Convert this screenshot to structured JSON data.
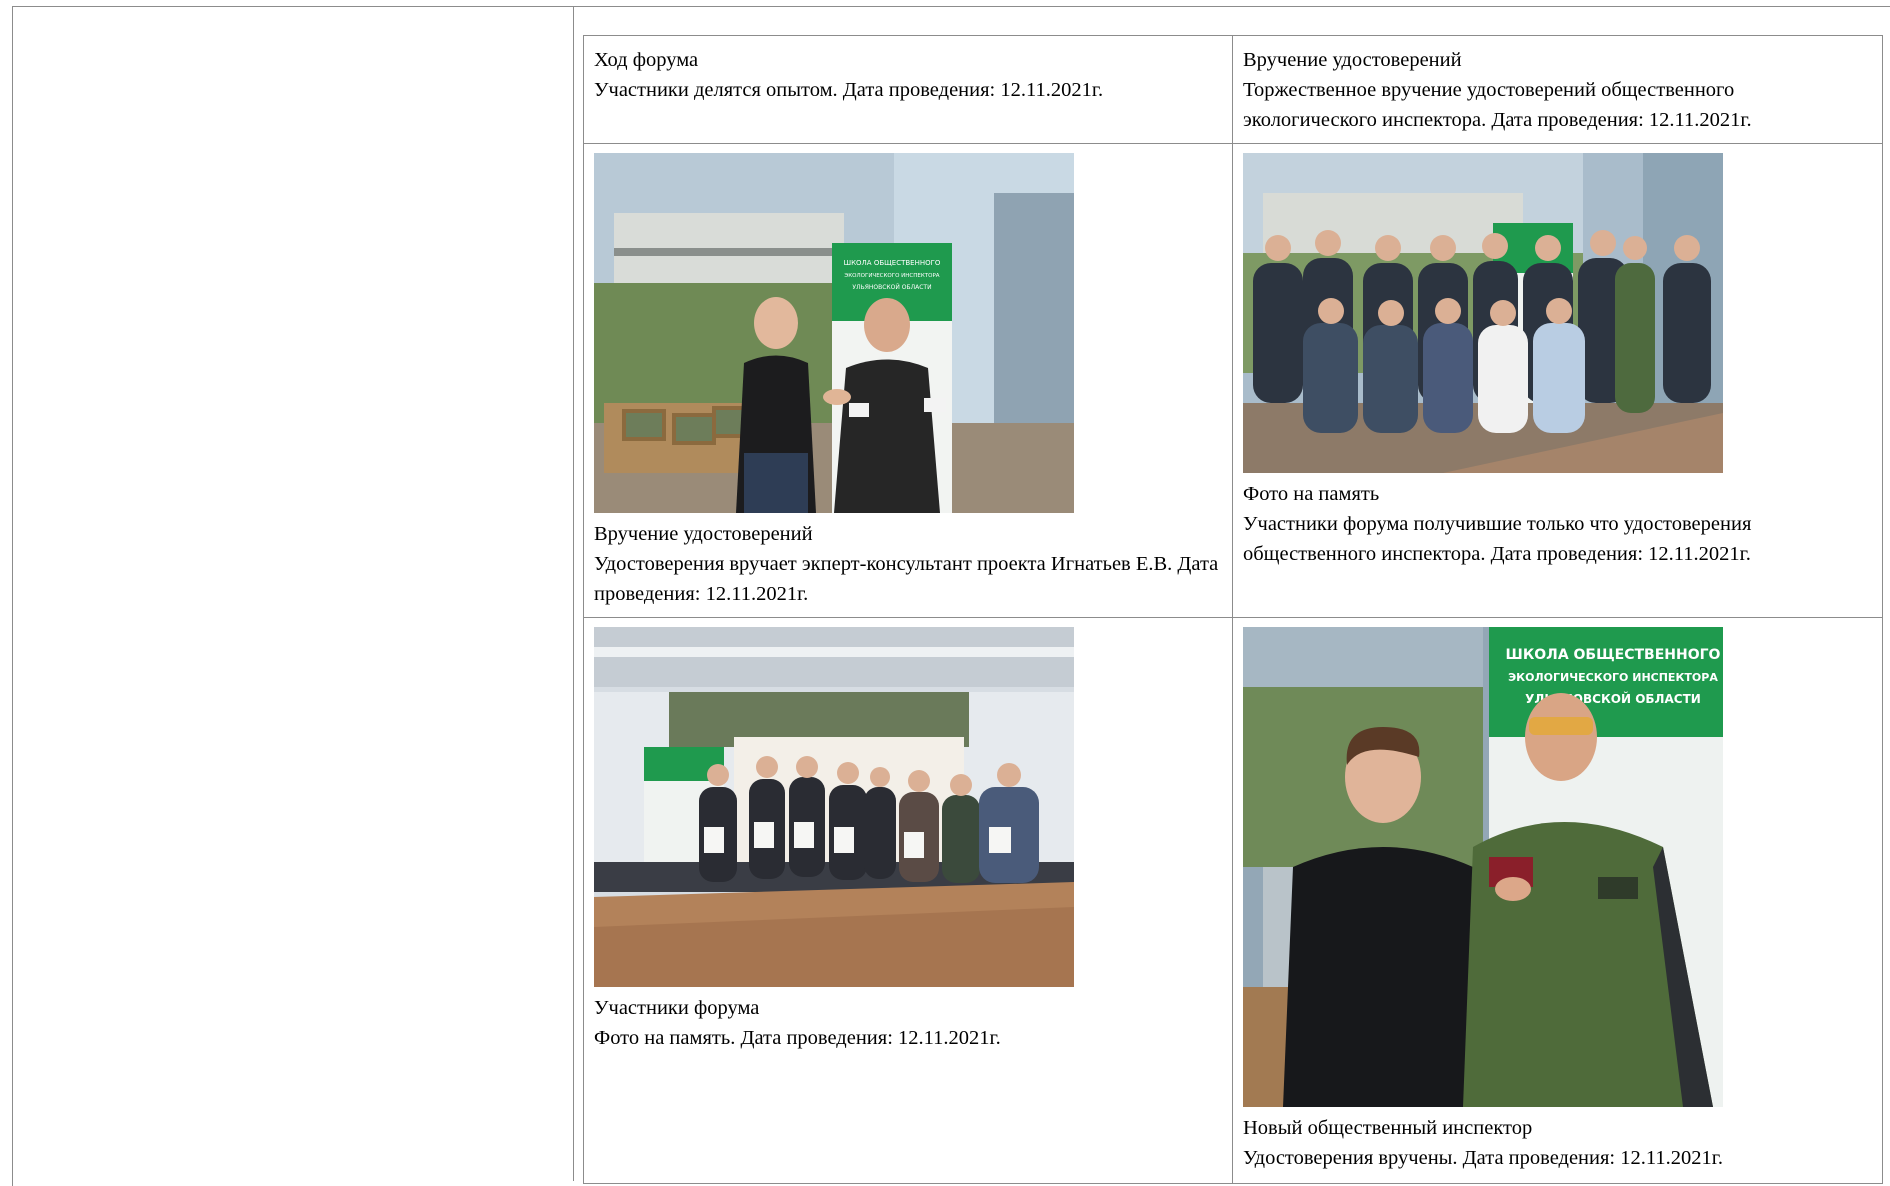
{
  "cells": [
    {
      "title": "Ход форума",
      "text": "Участники делятся опытом. Дата проведения: 12.11.2021г."
    },
    {
      "title": "Вручение удостоверений",
      "text": "Торжественное вручение удостоверений общественного экологического инспектора. Дата проведения: 12.11.2021г."
    },
    {
      "title": "Вручение удостоверений",
      "text": "Удостоверения вручает экперт-консультант проекта Игнатьев Е.В. Дата проведения: 12.11.2021г.",
      "photo": "handshake-certificate-photo"
    },
    {
      "title": "Фото на память",
      "text": "Участники форума получившие только что удостоверения общественного инспектора. Дата проведения: 12.11.2021г.",
      "photo": "group-seated-photo"
    },
    {
      "title": "Участники форума",
      "text": "Фото на память. Дата проведения: 12.11.2021г.",
      "photo": "group-standing-photo"
    },
    {
      "title": "Новый общественный инспектор",
      "text": "Удостоверения вручены. Дата проведения: 12.11.2021г.",
      "photo": "new-inspector-photo"
    }
  ],
  "banner": {
    "line1": "ШКОЛА ОБЩЕСТВЕННОГО",
    "line2": "ЭКОЛОГИЧЕСКОГО ИНСПЕКТОРА",
    "line3": "УЛЬЯНОВСКОЙ ОБЛАСТИ"
  },
  "colors": {
    "border": "#8c8c8c",
    "banner_green": "#1f9a4e",
    "jacket_green": "#4f6b3a"
  }
}
